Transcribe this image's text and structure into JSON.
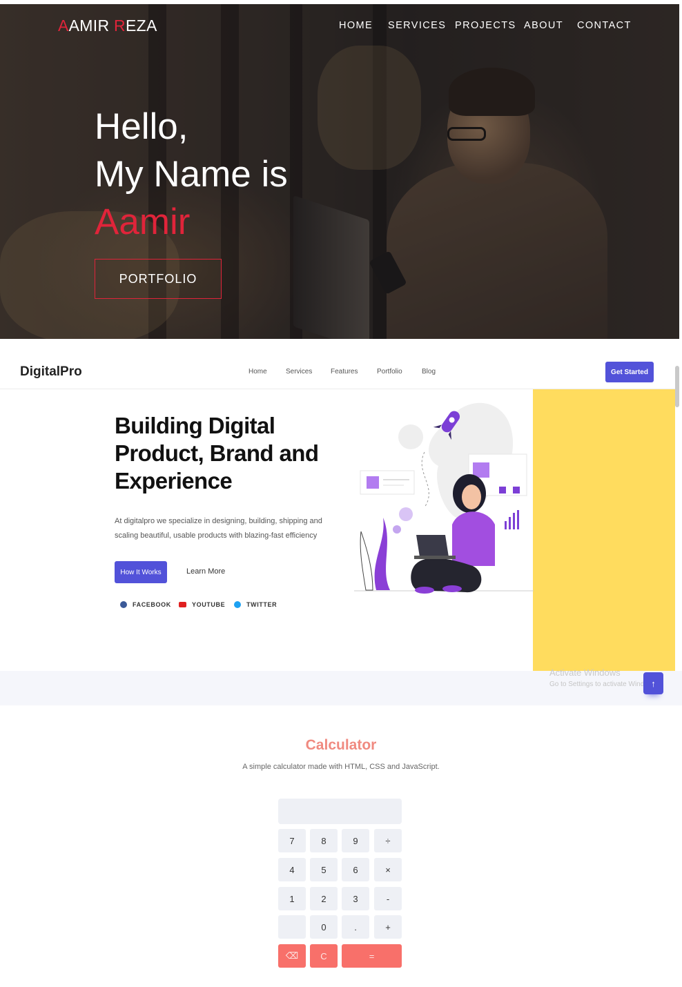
{
  "hero": {
    "brand_first_letter": "A",
    "brand_rest1": "AMIR ",
    "brand_r": "R",
    "brand_rest2": "EZA",
    "nav": [
      "HOME",
      "SERVICES",
      "PROJECTS",
      "ABOUT",
      "CONTACT"
    ],
    "line1": "Hello,",
    "line2": "My Name is",
    "name": "Aamir",
    "button": "PORTFOLIO",
    "accent_color": "#e0243a"
  },
  "digitalpro": {
    "logo": "DigitalPro",
    "nav": [
      "Home",
      "Services",
      "Features",
      "Portfolio",
      "Blog"
    ],
    "cta": "Get Started",
    "title": "Building Digital Product, Brand and Experience",
    "description": "At digitalpro we specialize in designing, building, shipping and scaling beautiful, usable products with blazing-fast efficiency",
    "primary_button": "How It Works",
    "secondary_link": "Learn More",
    "social": [
      "FACEBOOK",
      "YOUTUBE",
      "TWITTER"
    ],
    "accent_color": "#5252d9",
    "panel_color": "#ffdc5e"
  },
  "watermark": {
    "line1": "Activate Windows",
    "line2": "Go to Settings to activate Windows."
  },
  "calculator": {
    "title": "Calculator",
    "subtitle": "A simple calculator made with HTML, CSS and JavaScript.",
    "display_value": "",
    "keys": [
      [
        "7",
        "8",
        "9",
        "÷"
      ],
      [
        "4",
        "5",
        "6",
        "×"
      ],
      [
        "1",
        "2",
        "3",
        "-"
      ],
      [
        "",
        "0",
        ".",
        "+"
      ]
    ],
    "action_keys": [
      "⌫",
      "C",
      "="
    ],
    "accent_color": "#f08a80"
  }
}
